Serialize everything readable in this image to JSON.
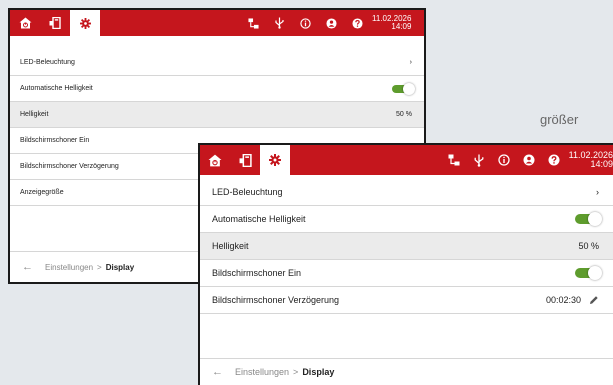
{
  "side_text": "größer",
  "accent": "#c5161d",
  "toggle_color": "#5e9c2d",
  "datetime": {
    "date": "11.02.2026",
    "time": "14:09"
  },
  "tabs": [
    {
      "name": "home-tab",
      "icon": "home-power-icon"
    },
    {
      "name": "device-tab",
      "icon": "device-icon"
    },
    {
      "name": "settings-tab",
      "icon": "gear-icon",
      "active": true
    }
  ],
  "status_icons": [
    "network-icon",
    "usb-icon",
    "info-icon",
    "user-icon",
    "help-icon"
  ],
  "rows": {
    "led": "LED-Beleuchtung",
    "led_chevron": "›",
    "auto_brightness": "Automatische Helligkeit",
    "brightness": "Helligkeit",
    "brightness_value": "50 %",
    "screensaver_on": "Bildschirmschoner Ein",
    "screensaver_delay": "Bildschirmschoner Verzögerung",
    "screensaver_delay_value": "00:02:30",
    "display_size": "Anzeigegröße"
  },
  "footer": {
    "back": "←",
    "crumb_parent": "Einstellungen",
    "crumb_sep": ">",
    "crumb_current": "Display"
  }
}
